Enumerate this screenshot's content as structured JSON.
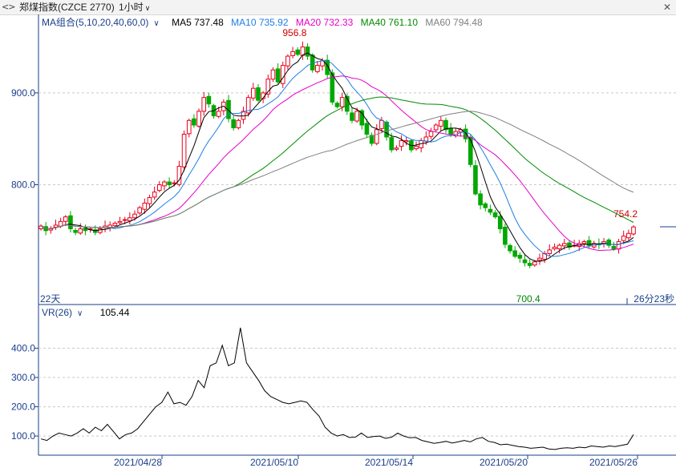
{
  "header": {
    "title": "郑煤指数(CZCE 2770)",
    "period": "1小时"
  },
  "indicator_legend": {
    "ma_group_label": "MA组合(5,10,20,40,60,0)",
    "ma5": "MA5 737.48",
    "ma10": "MA10 735.92",
    "ma20": "MA20 732.33",
    "ma40": "MA40 761.10",
    "ma60": "MA60 794.48"
  },
  "vr_legend": {
    "label": "VR(26)",
    "value": "105.44"
  },
  "colors": {
    "up": "#e8001c",
    "down": "#00a800",
    "ma5": "#000000",
    "ma10": "#1e7ee6",
    "ma20": "#e600c8",
    "ma40": "#008a00",
    "ma60": "#808080",
    "axis_label": "#1a3f8a",
    "grid": "#c9c9c9",
    "price_label": "#cc0000",
    "low_label": "#008a00"
  },
  "chart_data": [
    {
      "type": "candlestick",
      "y_ticks": [
        "900.0",
        "800.0"
      ],
      "ylim": [
        680,
        975
      ],
      "annotations": {
        "high": "956.8",
        "low": "700.4",
        "last": "754.2",
        "left_marker": "22天",
        "right_marker": "26分23秒"
      },
      "series": [
        {
          "name": "MA5",
          "value": 737.48
        },
        {
          "name": "MA10",
          "value": 735.92
        },
        {
          "name": "MA20",
          "value": 732.33
        },
        {
          "name": "MA40",
          "value": 761.1
        },
        {
          "name": "MA60",
          "value": 794.48
        }
      ],
      "closes": [
        755,
        750,
        752,
        756,
        760,
        765,
        752,
        748,
        752,
        750,
        752,
        748,
        752,
        755,
        756,
        758,
        760,
        762,
        764,
        768,
        775,
        780,
        786,
        792,
        800,
        803,
        800,
        802,
        820,
        855,
        870,
        865,
        880,
        895,
        888,
        875,
        880,
        890,
        872,
        862,
        870,
        880,
        895,
        905,
        892,
        900,
        915,
        925,
        912,
        930,
        940,
        945,
        942,
        950,
        940,
        925,
        930,
        935,
        920,
        890,
        885,
        895,
        880,
        870,
        880,
        865,
        855,
        845,
        860,
        870,
        852,
        838,
        840,
        848,
        848,
        838,
        842,
        848,
        852,
        858,
        865,
        870,
        860,
        855,
        858,
        860,
        850,
        822,
        790,
        778,
        775,
        770,
        765,
        752,
        735,
        728,
        722,
        720,
        715,
        712,
        716,
        720,
        725,
        729,
        732,
        734,
        736,
        732,
        734,
        736,
        738,
        734,
        736,
        735,
        738,
        734,
        730,
        738,
        744,
        747,
        754
      ]
    },
    {
      "type": "line",
      "name": "VR(26)",
      "y_ticks": [
        "400.0",
        "300.0",
        "200.0",
        "100.0"
      ],
      "ylim": [
        40,
        500
      ],
      "values": [
        90,
        85,
        100,
        110,
        105,
        100,
        110,
        125,
        110,
        130,
        118,
        140,
        115,
        90,
        105,
        110,
        125,
        150,
        175,
        200,
        215,
        250,
        210,
        215,
        205,
        235,
        290,
        265,
        340,
        350,
        410,
        340,
        350,
        470,
        350,
        320,
        290,
        255,
        235,
        225,
        215,
        210,
        215,
        220,
        215,
        190,
        168,
        130,
        110,
        100,
        105,
        95,
        96,
        110,
        95,
        98,
        100,
        92,
        96,
        110,
        100,
        94,
        95,
        85,
        80,
        75,
        78,
        82,
        76,
        80,
        85,
        80,
        90,
        95,
        82,
        78,
        70,
        72,
        68,
        64,
        62,
        58,
        60,
        62,
        56,
        54,
        58,
        60,
        58,
        62,
        60,
        66,
        64,
        62,
        66,
        64,
        68,
        72,
        105
      ]
    }
  ],
  "x_axis": {
    "labels": [
      "2021/04/28",
      "2021/05/10",
      "2021/05/14",
      "2021/05/20",
      "2021/05/26"
    ]
  }
}
